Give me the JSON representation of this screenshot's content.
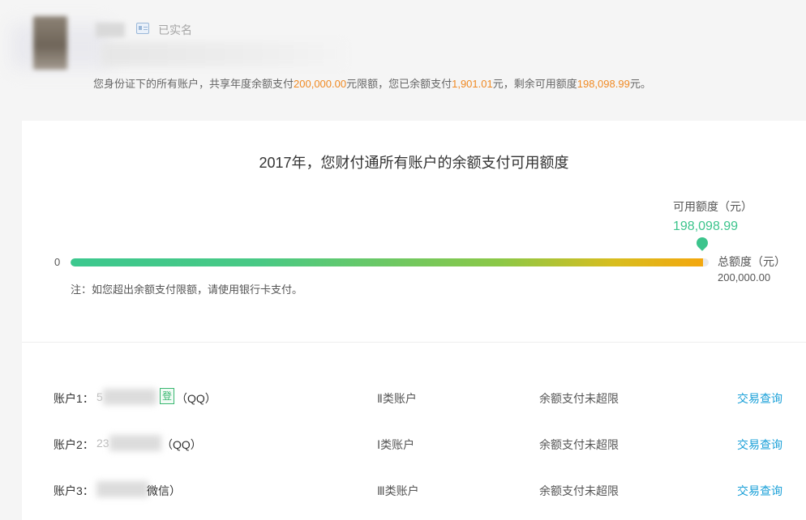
{
  "profile": {
    "verified_label": "已实名",
    "notice": {
      "prefix": "您身份证下的所有账户，共享年度余额支付",
      "annual_limit": "200,000.00",
      "mid1": "元限额，您已余额支付",
      "used": "1,901.01",
      "mid2": "元，剩余可用额度",
      "remaining": "198,098.99",
      "suffix": "元。"
    }
  },
  "quota": {
    "title": "2017年，您财付通所有账户的余额支付可用额度",
    "available_label": "可用额度（元）",
    "available_value": "198,098.99",
    "zero_label": "0",
    "total_label": "总额度（元）",
    "total_value": "200,000.00",
    "fill_fraction": 0.9905,
    "note": "注：如您超出余额支付限额，请使用银行卡支付。"
  },
  "accounts": [
    {
      "label": "账户1：",
      "id_visible": "5",
      "badge": "登",
      "channel": "（QQ）",
      "type": "Ⅱ类账户",
      "status": "余额支付未超限",
      "action": "交易查询"
    },
    {
      "label": "账户2：",
      "id_visible": "23",
      "badge": "",
      "channel": "（QQ）",
      "type": "Ⅰ类账户",
      "status": "余额支付未超限",
      "action": "交易查询"
    },
    {
      "label": "账户3：",
      "id_visible": "",
      "badge": "",
      "channel": "微信）",
      "type": "Ⅲ类账户",
      "status": "余额支付未超限",
      "action": "交易查询"
    }
  ],
  "colors": {
    "highlight": "#f08a24",
    "available": "#3cc48c",
    "link": "#1aa0d8",
    "badge": "#37b66f"
  }
}
